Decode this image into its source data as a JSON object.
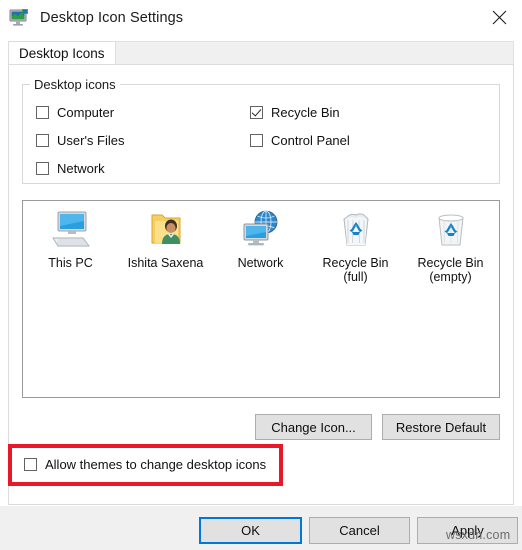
{
  "window": {
    "title": "Desktop Icon Settings",
    "icon": "monitor-icon",
    "close_label": "✕"
  },
  "tabs": [
    {
      "label": "Desktop Icons",
      "selected": true
    }
  ],
  "group": {
    "legend": "Desktop icons",
    "checkboxes": [
      {
        "label": "Computer",
        "checked": false
      },
      {
        "label": "User's Files",
        "checked": false
      },
      {
        "label": "Network",
        "checked": false
      },
      {
        "label": "Recycle Bin",
        "checked": true
      },
      {
        "label": "Control Panel",
        "checked": false
      }
    ]
  },
  "preview": {
    "icons": [
      {
        "caption": "This PC",
        "icon": "this-pc-icon"
      },
      {
        "caption": "Ishita Saxena",
        "icon": "user-folder-icon"
      },
      {
        "caption": "Network",
        "icon": "network-icon"
      },
      {
        "caption": "Recycle Bin\n(full)",
        "icon": "recycle-bin-full-icon"
      },
      {
        "caption": "Recycle Bin\n(empty)",
        "icon": "recycle-bin-empty-icon"
      }
    ]
  },
  "icon_buttons": {
    "change_icon": "Change Icon...",
    "restore_default": "Restore Default"
  },
  "theme_option": {
    "label": "Allow themes to change desktop icons",
    "checked": false,
    "highlight_color": "#e8172a"
  },
  "footer_buttons": {
    "ok": "OK",
    "cancel": "Cancel",
    "apply": "Apply"
  },
  "watermark": "wsxdn.com",
  "colors": {
    "accent": "#0078d7",
    "dialog_bg": "#ffffff",
    "footer_bg": "#f0f0f0",
    "button_face": "#e1e1e1"
  }
}
